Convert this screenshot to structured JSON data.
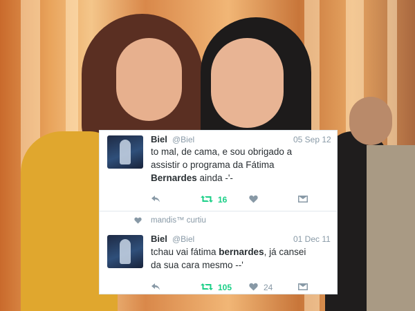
{
  "tweets": [
    {
      "name": "Biel",
      "handle": "@Biel",
      "date": "05 Sep 12",
      "text_parts": [
        "to mal, de cama, e sou obrigado a",
        "assistir o programa da Fátima",
        "Bernardes",
        " ainda -'-"
      ],
      "retweets": "16",
      "likes": ""
    },
    {
      "liked_by": "mandis™ curtiu",
      "name": "Biel",
      "handle": "@Biel",
      "date": "01 Dec 11",
      "text_parts": [
        "tchau vai fátima ",
        "bernardes",
        ", já cansei",
        "da sua cara mesmo --'"
      ],
      "retweets": "105",
      "likes": "24"
    }
  ],
  "colors": {
    "retweet_green": "#19cf86",
    "muted": "#8899a6",
    "text": "#292f33"
  },
  "icons": [
    "reply-icon",
    "retweet-icon",
    "heart-icon",
    "dm-icon",
    "avatar"
  ]
}
